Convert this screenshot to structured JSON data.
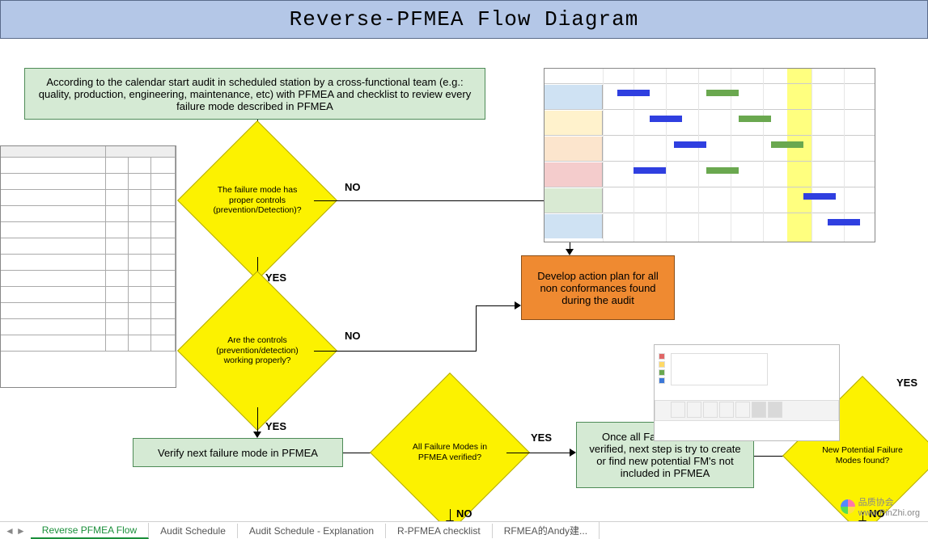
{
  "page_title": "Reverse-PFMEA Flow Diagram",
  "nodes": {
    "start": "According to the calendar start audit in scheduled station by a cross-functional team (e.g.: quality, production, engineering, maintenance, etc) with PFMEA and checklist to review every failure mode described in PFMEA",
    "d1": "The failure mode has proper controls (prevention/Detection)?",
    "d2": "Are the controls (prevention/detection) working properly?",
    "verify": "Verify next failure mode in PFMEA",
    "d3": "All Failure Modes in PFMEA verified?",
    "action": "Develop action plan for all non conformances found during the audit",
    "once": "Once all Failure Modes are verified, next step is try to create or find new potential FM's not included in PFMEA",
    "d4": "New Potential Failure Modes found?"
  },
  "labels": {
    "yes": "YES",
    "no": "NO"
  },
  "tabs": [
    "Reverse PFMEA Flow",
    "Audit Schedule",
    "Audit Schedule - Explanation",
    "R-PFMEA checklist",
    "RFMEA的Andy建..."
  ],
  "active_tab": 0,
  "watermark_text1": "品质协会",
  "watermark_text2": "www.PinZhi.org"
}
